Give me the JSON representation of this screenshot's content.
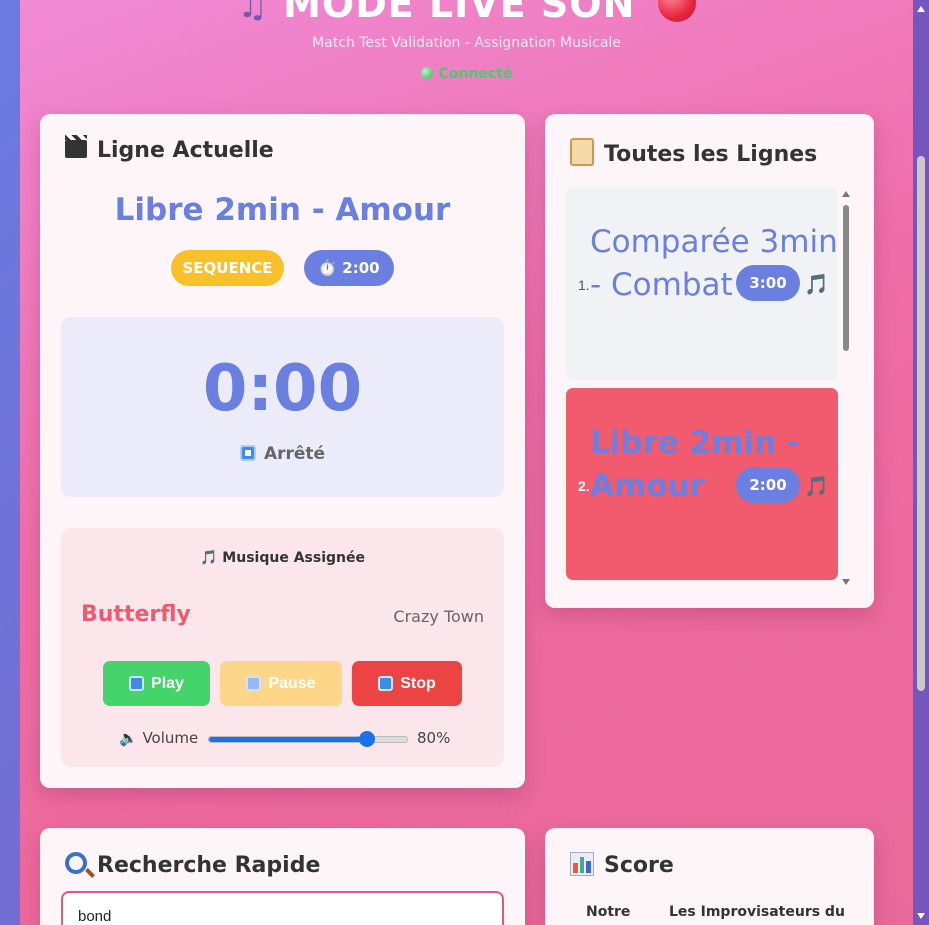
{
  "header": {
    "title": "MODE LIVE SON",
    "title_icon": "musical-notes",
    "title_icon_right": "red-ball",
    "subtitle": "Match Test Validation - Assignation Musicale",
    "connection_status": "Connecté"
  },
  "current_line": {
    "card_title": "Ligne Actuelle",
    "card_icon": "clapper-board",
    "title": "Libre 2min - Amour",
    "type_badge": "SEQUENCE",
    "duration_badge": "⏱️ 2:00",
    "timer": "0:00",
    "state": "Arrêté",
    "music": {
      "header": "🎵 Musique Assignée",
      "song": "Butterfly",
      "artist": "Crazy Town",
      "buttons": {
        "play": "Play",
        "pause": "Pause",
        "stop": "Stop"
      },
      "volume_label": "🔈 Volume",
      "volume_value": 0.8,
      "volume_display": "80%"
    }
  },
  "all_lines": {
    "card_title": "Toutes les Lignes",
    "card_icon": "scroll",
    "items": [
      {
        "num": "1.",
        "name": "Comparée 3min - Combat",
        "duration": "3:00",
        "icon": "🎵"
      },
      {
        "num": "2.",
        "name": "Libre 2min - Amour",
        "duration": "2:00",
        "icon": "🎵"
      }
    ]
  },
  "search": {
    "card_title": "Recherche Rapide",
    "card_icon": "magnifier",
    "value": "bond"
  },
  "score": {
    "card_title": "Score",
    "card_icon": "bar-chart",
    "columns": [
      "Notre",
      "Les Improvisateurs du"
    ]
  },
  "colors": {
    "accent": "#6a7fe0",
    "badge_yellow": "#f8c12a",
    "active_row": "#f25a6e",
    "play": "#45d46b",
    "pause": "#fdd68a",
    "stop": "#ec4444"
  }
}
